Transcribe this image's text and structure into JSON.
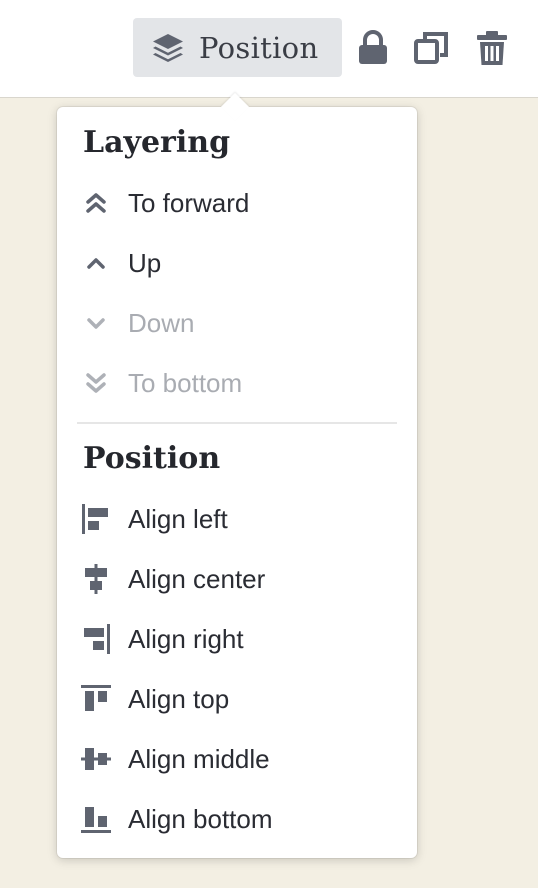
{
  "toolbar": {
    "position_button_label": "Position",
    "icons": [
      "layers-icon",
      "lock-icon",
      "duplicate-icon",
      "trash-icon"
    ],
    "accent_bg": "#e3e5e8",
    "icon_color": "#5f6470"
  },
  "menu": {
    "layering_title": "Layering",
    "layering_items": [
      {
        "label": "To forward",
        "icon": "double-chevron-up-icon",
        "disabled": false
      },
      {
        "label": "Up",
        "icon": "chevron-up-icon",
        "disabled": false
      },
      {
        "label": "Down",
        "icon": "chevron-down-icon",
        "disabled": true
      },
      {
        "label": "To bottom",
        "icon": "double-chevron-down-icon",
        "disabled": true
      }
    ],
    "position_title": "Position",
    "position_items": [
      {
        "label": "Align left",
        "icon": "align-left-icon"
      },
      {
        "label": "Align center",
        "icon": "align-center-icon"
      },
      {
        "label": "Align right",
        "icon": "align-right-icon"
      },
      {
        "label": "Align top",
        "icon": "align-top-icon"
      },
      {
        "label": "Align middle",
        "icon": "align-middle-icon"
      },
      {
        "label": "Align bottom",
        "icon": "align-bottom-icon"
      }
    ]
  }
}
